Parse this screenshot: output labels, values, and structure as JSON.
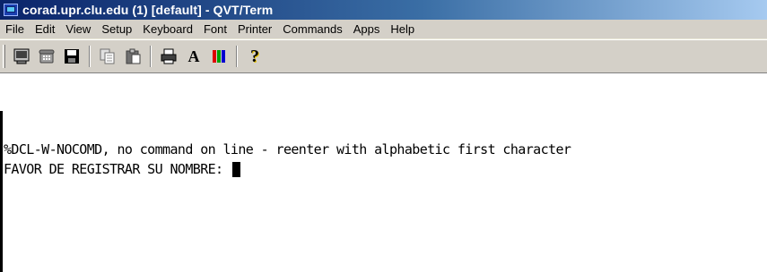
{
  "window": {
    "title": "corad.upr.clu.edu (1) [default] - QVT/Term"
  },
  "menu": {
    "items": [
      "File",
      "Edit",
      "View",
      "Setup",
      "Keyboard",
      "Font",
      "Printer",
      "Commands",
      "Apps",
      "Help"
    ]
  },
  "toolbar": {
    "buttons": [
      {
        "icon": "terminal-icon"
      },
      {
        "icon": "phone-icon"
      },
      {
        "icon": "save-icon"
      },
      {
        "icon": "copy-icon"
      },
      {
        "icon": "paste-icon"
      },
      {
        "icon": "print-icon"
      },
      {
        "icon": "font-icon",
        "glyph": "A"
      },
      {
        "icon": "color-icon"
      },
      {
        "icon": "help-icon",
        "glyph": "?"
      }
    ]
  },
  "terminal": {
    "lines": [
      "%DCL-W-NOCOMD, no command on line - reenter with alphabetic first character",
      "FAVOR DE REGISTRAR SU NOMBRE: "
    ]
  },
  "colors": {
    "title_start": "#0a246a",
    "title_end": "#a6caf0",
    "chrome": "#d4d0c8",
    "terminal_bg": "#ffffff",
    "terminal_fg": "#000000"
  }
}
